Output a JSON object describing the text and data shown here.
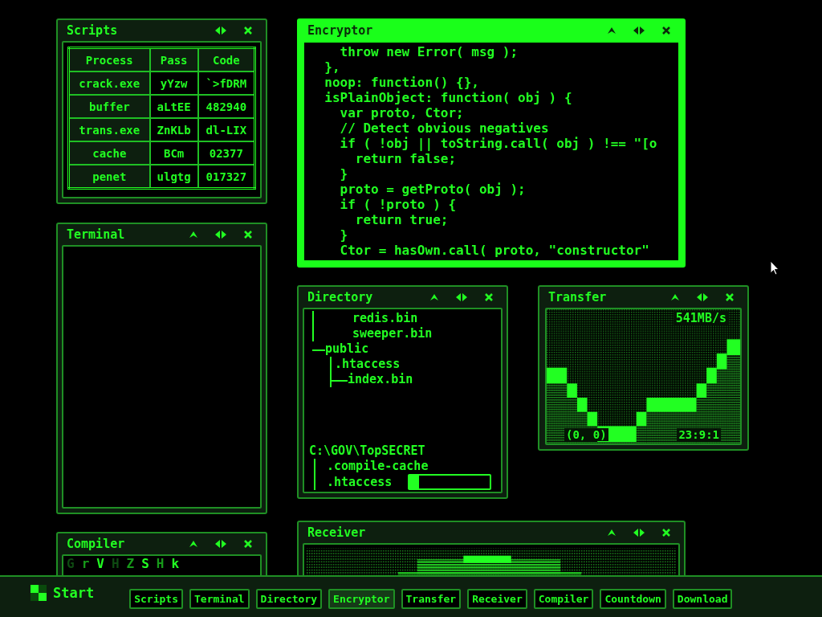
{
  "windows": [
    {
      "kind": "scripts",
      "title": "Scripts",
      "active": false,
      "minimizable": false,
      "table": {
        "columns": [
          "Process",
          "Pass",
          "Code"
        ],
        "rows": [
          [
            "crack.exe",
            "yYzw",
            "`>fDRM"
          ],
          [
            "buffer",
            "aLtEE",
            "482940"
          ],
          [
            "trans.exe",
            "ZnKLb",
            "dl-LIX"
          ],
          [
            "cache",
            "BCm",
            "02377"
          ],
          [
            "penet",
            "ulgtg",
            "017327"
          ]
        ]
      }
    },
    {
      "kind": "encryptor",
      "title": "Encryptor",
      "active": true,
      "minimizable": true,
      "code_lines": [
        "    throw new Error( msg );",
        "  },",
        "  noop: function() {},",
        "  isPlainObject: function( obj ) {",
        "    var proto, Ctor;",
        "    // Detect obvious negatives",
        "    if ( !obj || toString.call( obj ) !== \"[o",
        "      return false;",
        "    }",
        "    proto = getProto( obj );",
        "    if ( !proto ) {",
        "      return true;",
        "    }",
        "    Ctor = hasOwn.call( proto, \"constructor\""
      ]
    },
    {
      "kind": "terminal",
      "title": "Terminal",
      "active": false,
      "minimizable": true
    },
    {
      "kind": "directory",
      "title": "Directory",
      "active": false,
      "minimizable": true,
      "tree": [
        {
          "label": "redis.bin"
        },
        {
          "label": "sweeper.bin"
        },
        {
          "label": "public",
          "children": [
            {
              "label": ".htaccess",
              "children": [
                {
                  "label": "index.bin"
                }
              ]
            }
          ]
        }
      ],
      "path": "C:\\GOV\\TopSECRET",
      "path_children": [
        ".compile-cache",
        ".htaccess"
      ],
      "progress": {
        "level": 0.12
      }
    },
    {
      "kind": "transfer",
      "title": "Transfer",
      "active": false,
      "minimizable": true,
      "rate": "541MB/s",
      "coords": "(0, 0)",
      "time": "23:9:1"
    },
    {
      "kind": "compiler",
      "title": "Compiler",
      "active": false,
      "minimizable": true,
      "glyphs": [
        {
          "char": "G",
          "kind": "dim"
        },
        {
          "char": "r",
          "kind": "mid"
        },
        {
          "char": "V",
          "kind": "bright"
        },
        {
          "char": "H",
          "kind": "dim"
        },
        {
          "char": "Z",
          "kind": "mid"
        },
        {
          "char": "S",
          "kind": "bright"
        },
        {
          "char": "H",
          "kind": "mid"
        },
        {
          "char": "k",
          "kind": "bright"
        }
      ]
    },
    {
      "kind": "receiver",
      "title": "Receiver",
      "active": false,
      "minimizable": true
    }
  ],
  "taskbar": {
    "start": "Start",
    "buttons": [
      {
        "label": "Scripts",
        "selected": false
      },
      {
        "label": "Terminal",
        "selected": false
      },
      {
        "label": "Directory",
        "selected": false
      },
      {
        "label": "Encryptor",
        "selected": true
      },
      {
        "label": "Transfer",
        "selected": false
      },
      {
        "label": "Receiver",
        "selected": false
      },
      {
        "label": "Compiler",
        "selected": false
      },
      {
        "label": "Countdown",
        "selected": false
      },
      {
        "label": "Download",
        "selected": false
      }
    ]
  }
}
